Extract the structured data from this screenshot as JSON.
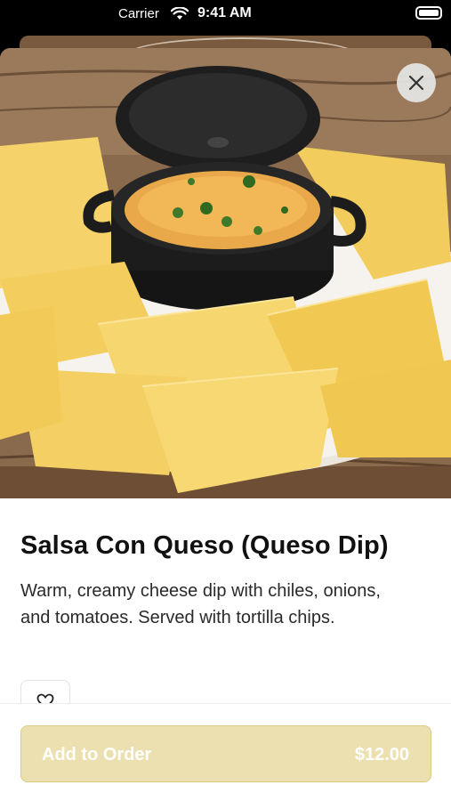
{
  "status_bar": {
    "carrier": "Carrier",
    "time": "9:41 AM",
    "battery_level": 1.0
  },
  "icons": {
    "wifi": "wifi-icon",
    "battery": "battery-icon",
    "close": "close-icon",
    "favorite": "heart-outline-icon"
  },
  "item": {
    "image_alt": "",
    "title": "Salsa Con Queso (Queso Dip)",
    "description": "Warm, creamy cheese dip with chiles, onions, and tomatoes. Served with tortilla chips."
  },
  "footer": {
    "add_label": "Add to Order",
    "price": "$12.00"
  },
  "colors": {
    "accent": "#ede0b0",
    "accent_border": "#ddc98a",
    "button_text": "#ffffff",
    "title_text": "#111111"
  }
}
